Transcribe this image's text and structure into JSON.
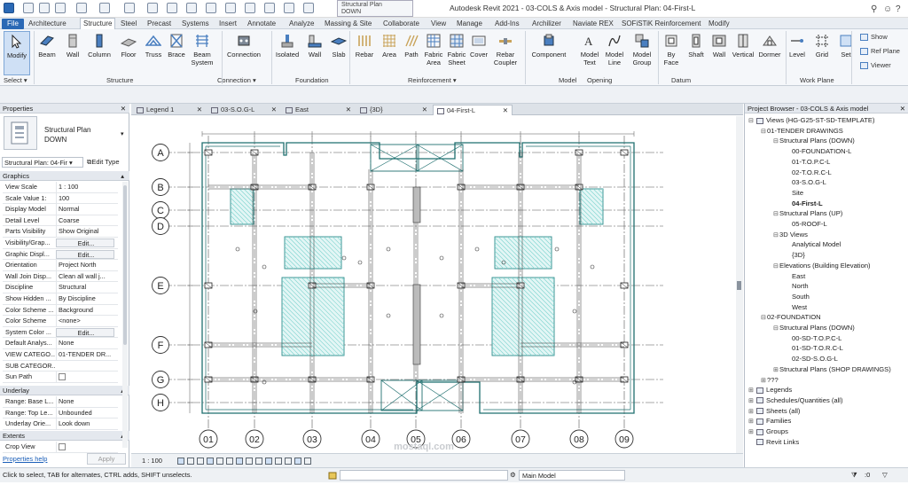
{
  "app": {
    "title": "Autodesk Revit 2021 - 03-COLS & Axis model - Structural Plan: 04-First-L",
    "view_dropdown_line1": "Structural Plan",
    "view_dropdown_line2": "DOWN"
  },
  "ribbon_tabs": [
    "File",
    "Architecture",
    "Structure",
    "Steel",
    "Precast",
    "Systems",
    "Insert",
    "Annotate",
    "Analyze",
    "Massing & Site",
    "Collaborate",
    "View",
    "Manage",
    "Add-Ins",
    "Archilizer",
    "Naviate REX",
    "SOFiSTiK Reinforcement",
    "Modify"
  ],
  "ribbon": {
    "buttons": [
      {
        "label": "Modify",
        "icon": "cursor-icon"
      },
      {
        "label": "Beam",
        "icon": "beam-icon"
      },
      {
        "label": "Wall",
        "icon": "wall-icon"
      },
      {
        "label": "Column",
        "icon": "column-icon"
      },
      {
        "label": "Floor",
        "icon": "floor-icon"
      },
      {
        "label": "Truss",
        "icon": "truss-icon"
      },
      {
        "label": "Brace",
        "icon": "brace-icon"
      },
      {
        "label": "Beam\nSystem",
        "icon": "beam-system-icon"
      },
      {
        "label": "Connection",
        "icon": "connection-icon"
      },
      {
        "label": "Isolated",
        "icon": "isolated-footing-icon"
      },
      {
        "label": "Wall",
        "icon": "wall-footing-icon"
      },
      {
        "label": "Slab",
        "icon": "slab-icon"
      },
      {
        "label": "Rebar",
        "icon": "rebar-icon"
      },
      {
        "label": "Area",
        "icon": "area-rebar-icon"
      },
      {
        "label": "Path",
        "icon": "path-rebar-icon"
      },
      {
        "label": "Fabric\nArea",
        "icon": "fabric-area-icon"
      },
      {
        "label": "Fabric\nSheet",
        "icon": "fabric-sheet-icon"
      },
      {
        "label": "Cover",
        "icon": "cover-icon"
      },
      {
        "label": "Rebar\nCoupler",
        "icon": "rebar-coupler-icon"
      },
      {
        "label": "Component",
        "icon": "component-icon"
      },
      {
        "label": "Model\nText",
        "icon": "model-text-icon"
      },
      {
        "label": "Model\nLine",
        "icon": "model-line-icon"
      },
      {
        "label": "Model\nGroup",
        "icon": "model-group-icon"
      },
      {
        "label": "By\nFace",
        "icon": "by-face-icon"
      },
      {
        "label": "Shaft",
        "icon": "shaft-icon"
      },
      {
        "label": "Wall",
        "icon": "wall-opening-icon"
      },
      {
        "label": "Vertical",
        "icon": "vertical-opening-icon"
      },
      {
        "label": "Dormer",
        "icon": "dormer-icon"
      },
      {
        "label": "Level",
        "icon": "level-icon"
      },
      {
        "label": "Grid",
        "icon": "grid-icon"
      },
      {
        "label": "Set",
        "icon": "set-icon"
      }
    ],
    "small_buttons": [
      "Show",
      "Ref Plane",
      "Viewer"
    ],
    "panels": [
      "Select ▾",
      "Structure",
      "Connection ▾",
      "Foundation",
      "Reinforcement ▾",
      "Model",
      "Opening",
      "Datum",
      "Work Plane"
    ]
  },
  "properties": {
    "header": "Properties",
    "type_name": "Structural Plan",
    "type_sub": "DOWN",
    "selector": "Structural Plan: 04-Fir ▾",
    "edit_type": "Edit Type",
    "groups": {
      "graphics": "Graphics",
      "underlay": "Underlay",
      "extents": "Extents"
    },
    "rows": [
      {
        "k": "View Scale",
        "v": "1 : 100"
      },
      {
        "k": "Scale Value   1:",
        "v": "100"
      },
      {
        "k": "Display Model",
        "v": "Normal"
      },
      {
        "k": "Detail Level",
        "v": "Coarse"
      },
      {
        "k": "Parts Visibility",
        "v": "Show Original"
      },
      {
        "k": "Visibility/Grap...",
        "v": "Edit..."
      },
      {
        "k": "Graphic Displ...",
        "v": "Edit..."
      },
      {
        "k": "Orientation",
        "v": "Project North"
      },
      {
        "k": "Wall Join Disp...",
        "v": "Clean all wall j..."
      },
      {
        "k": "Discipline",
        "v": "Structural"
      },
      {
        "k": "Show Hidden ...",
        "v": "By Discipline"
      },
      {
        "k": "Color Scheme ...",
        "v": "Background"
      },
      {
        "k": "Color Scheme",
        "v": "<none>"
      },
      {
        "k": "System Color ...",
        "v": "Edit..."
      },
      {
        "k": "Default Analys...",
        "v": "None"
      },
      {
        "k": "VIEW CATEGO...",
        "v": "01-TENDER DR..."
      },
      {
        "k": "SUB CATEGOR...",
        "v": ""
      },
      {
        "k": "Sun Path",
        "v": ""
      }
    ],
    "underlay_rows": [
      {
        "k": "Range: Base L...",
        "v": "None"
      },
      {
        "k": "Range: Top Le...",
        "v": "Unbounded"
      },
      {
        "k": "Underlay Orie...",
        "v": "Look down"
      }
    ],
    "extents_rows": [
      {
        "k": "Crop View",
        "v": ""
      }
    ],
    "help": "Properties help",
    "apply": "Apply"
  },
  "view_tabs": [
    {
      "label": "Legend 1",
      "icon": "legend-icon"
    },
    {
      "label": "03-S.O.G-L",
      "icon": "plan-icon"
    },
    {
      "label": "East",
      "icon": "elevation-icon"
    },
    {
      "label": "{3D}",
      "icon": "3d-icon"
    },
    {
      "label": "04-First-L",
      "icon": "plan-icon",
      "active": true
    }
  ],
  "drawing": {
    "grid_rows": [
      "A",
      "B",
      "C",
      "D",
      "E",
      "F",
      "G",
      "H"
    ],
    "grid_cols": [
      "01",
      "02",
      "03",
      "04",
      "05",
      "06",
      "07",
      "08",
      "09"
    ],
    "watermark": "mostaql.com"
  },
  "view_control": {
    "scale": "1 : 100"
  },
  "browser": {
    "header": "Project Browser - 03-COLS & Axis model",
    "tree": [
      {
        "d": 0,
        "t": "−",
        "label": "Views (HG-G25-ST-SD-TEMPLATE)",
        "icon": "views-icon"
      },
      {
        "d": 1,
        "t": "−",
        "label": "01-TENDER DRAWINGS"
      },
      {
        "d": 2,
        "t": "−",
        "label": "Structural Plans (DOWN)"
      },
      {
        "d": 3,
        "t": "",
        "label": "00-FOUNDATION-L"
      },
      {
        "d": 3,
        "t": "",
        "label": "01-T.O.P.C-L"
      },
      {
        "d": 3,
        "t": "",
        "label": "02-T.O.R.C-L"
      },
      {
        "d": 3,
        "t": "",
        "label": "03-S.O.G-L"
      },
      {
        "d": 3,
        "t": "",
        "label": "Site"
      },
      {
        "d": 3,
        "t": "",
        "label": "04-First-L",
        "sel": true
      },
      {
        "d": 2,
        "t": "−",
        "label": "Structural Plans (UP)"
      },
      {
        "d": 3,
        "t": "",
        "label": "05-ROOF-L"
      },
      {
        "d": 2,
        "t": "−",
        "label": "3D Views"
      },
      {
        "d": 3,
        "t": "",
        "label": "Analytical Model"
      },
      {
        "d": 3,
        "t": "",
        "label": "{3D}"
      },
      {
        "d": 2,
        "t": "−",
        "label": "Elevations (Building Elevation)"
      },
      {
        "d": 3,
        "t": "",
        "label": "East"
      },
      {
        "d": 3,
        "t": "",
        "label": "North"
      },
      {
        "d": 3,
        "t": "",
        "label": "South"
      },
      {
        "d": 3,
        "t": "",
        "label": "West"
      },
      {
        "d": 1,
        "t": "−",
        "label": "02-FOUNDATION"
      },
      {
        "d": 2,
        "t": "−",
        "label": "Structural Plans (DOWN)"
      },
      {
        "d": 3,
        "t": "",
        "label": "00-SD-T.O.P.C-L"
      },
      {
        "d": 3,
        "t": "",
        "label": "01-SD-T.O.R.C-L"
      },
      {
        "d": 3,
        "t": "",
        "label": "02-SD-S.O.G-L"
      },
      {
        "d": 2,
        "t": "+",
        "label": "Structural Plans (SHOP DRAWINGS)"
      },
      {
        "d": 1,
        "t": "+",
        "label": "???"
      },
      {
        "d": 0,
        "t": "+",
        "label": "Legends",
        "icon": "legend-icon"
      },
      {
        "d": 0,
        "t": "+",
        "label": "Schedules/Quantities (all)",
        "icon": "schedule-icon"
      },
      {
        "d": 0,
        "t": "+",
        "label": "Sheets (all)",
        "icon": "sheet-icon"
      },
      {
        "d": 0,
        "t": "+",
        "label": "Families",
        "icon": "families-icon"
      },
      {
        "d": 0,
        "t": "+",
        "label": "Groups",
        "icon": "groups-icon"
      },
      {
        "d": 0,
        "t": "",
        "label": "Revit Links",
        "icon": "link-icon"
      }
    ]
  },
  "status": {
    "message": "Click to select, TAB for alternates, CTRL adds, SHIFT unselects.",
    "model": "Main Model",
    "zero": ":0"
  }
}
